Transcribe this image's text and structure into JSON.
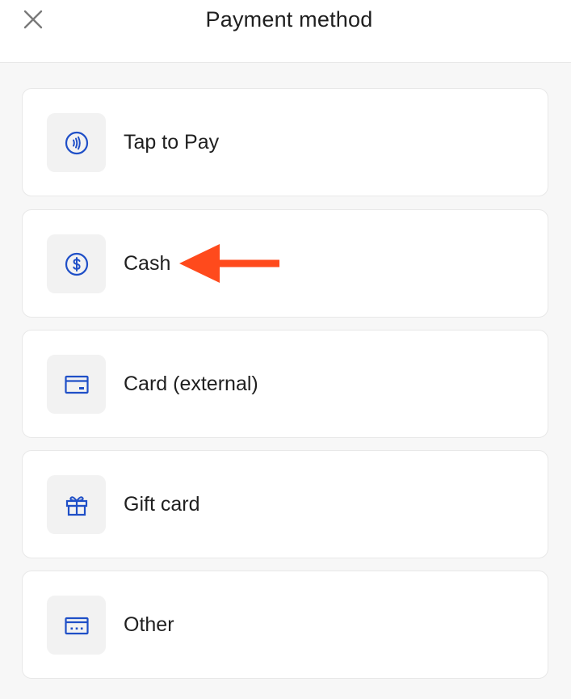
{
  "header": {
    "title": "Payment method",
    "close_icon": "close-icon"
  },
  "payment_methods": [
    {
      "label": "Tap to Pay",
      "icon": "contactless-icon"
    },
    {
      "label": "Cash",
      "icon": "dollar-circle-icon"
    },
    {
      "label": "Card (external)",
      "icon": "card-icon"
    },
    {
      "label": "Gift card",
      "icon": "gift-icon"
    },
    {
      "label": "Other",
      "icon": "other-card-icon"
    }
  ],
  "annotation": {
    "arrow_icon": "arrow-left-icon",
    "arrow_color": "#ff4a1c"
  },
  "colors": {
    "icon_accent": "#1f4fc7",
    "background": "#f7f7f7",
    "card": "#ffffff",
    "icon_tile": "#f2f2f2"
  }
}
